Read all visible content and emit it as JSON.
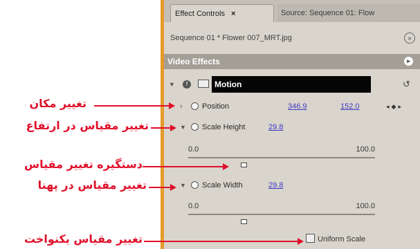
{
  "tabs": {
    "active_label": "Effect Controls",
    "active_close": "×",
    "inactive_label": "Source: Sequence 01: Flow"
  },
  "sequence": {
    "label": "Sequence 01 * Flower 007_MRT.jpg"
  },
  "video_effects": {
    "label": "Video Effects"
  },
  "motion": {
    "label": "Motion"
  },
  "position": {
    "label": "Position",
    "x": "346.9",
    "y": "152.0"
  },
  "scale_height": {
    "label": "Scale Height",
    "value": "29.8",
    "min": "0.0",
    "max": "100.0",
    "level_fraction": 0.298
  },
  "scale_width": {
    "label": "Scale Width",
    "value": "29.8",
    "min": "0.0",
    "max": "100.0",
    "level_fraction": 0.298
  },
  "uniform_scale": {
    "label": "Uniform Scale",
    "checked": false
  },
  "annotations": {
    "position": "تغییر مکان",
    "scale_height": "تغییر مقیاس در ارتفاع",
    "slider_handle": "دستگیره تغییر مقیاس",
    "scale_width": "تغییر مقیاس در پهنا",
    "uniform_scale": "تغییر مقیاس یکنواخت"
  },
  "colors": {
    "annotation": "#e0102a",
    "panel": "#d9d5cc",
    "value_link": "#3d37c4",
    "panel_edge": "#e59a2b"
  }
}
